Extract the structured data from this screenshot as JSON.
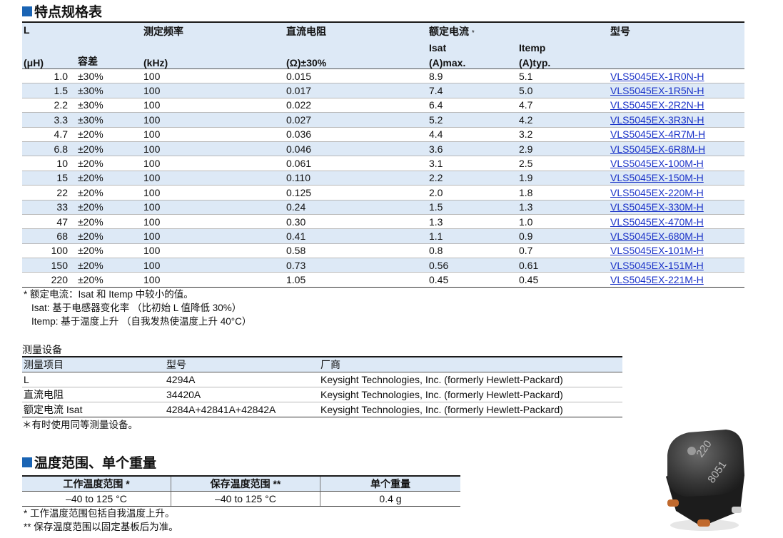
{
  "spec_section": {
    "title": "特点规格表",
    "headers": {
      "l": "L",
      "l_unit": "(μH)",
      "tolerance": "容差",
      "freq": "测定频率",
      "freq_unit": "(kHz)",
      "dcr": "直流电阻",
      "dcr_unit": "(Ω)±30%",
      "rated_current": "额定电流",
      "rated_star": "*",
      "isat": "Isat",
      "isat_unit": "(A)max.",
      "itemp": "Itemp",
      "itemp_unit": "(A)typ.",
      "part_no": "型号"
    },
    "rows": [
      {
        "l": "1.0",
        "tol": "±30%",
        "freq": "100",
        "dcr": "0.015",
        "isat": "8.9",
        "itemp": "5.1",
        "part": "VLS5045EX-1R0N-H"
      },
      {
        "l": "1.5",
        "tol": "±30%",
        "freq": "100",
        "dcr": "0.017",
        "isat": "7.4",
        "itemp": "5.0",
        "part": "VLS5045EX-1R5N-H"
      },
      {
        "l": "2.2",
        "tol": "±30%",
        "freq": "100",
        "dcr": "0.022",
        "isat": "6.4",
        "itemp": "4.7",
        "part": "VLS5045EX-2R2N-H"
      },
      {
        "l": "3.3",
        "tol": "±30%",
        "freq": "100",
        "dcr": "0.027",
        "isat": "5.2",
        "itemp": "4.2",
        "part": "VLS5045EX-3R3N-H"
      },
      {
        "l": "4.7",
        "tol": "±20%",
        "freq": "100",
        "dcr": "0.036",
        "isat": "4.4",
        "itemp": "3.2",
        "part": "VLS5045EX-4R7M-H"
      },
      {
        "l": "6.8",
        "tol": "±20%",
        "freq": "100",
        "dcr": "0.046",
        "isat": "3.6",
        "itemp": "2.9",
        "part": "VLS5045EX-6R8M-H"
      },
      {
        "l": "10",
        "tol": "±20%",
        "freq": "100",
        "dcr": "0.061",
        "isat": "3.1",
        "itemp": "2.5",
        "part": "VLS5045EX-100M-H"
      },
      {
        "l": "15",
        "tol": "±20%",
        "freq": "100",
        "dcr": "0.110",
        "isat": "2.2",
        "itemp": "1.9",
        "part": "VLS5045EX-150M-H"
      },
      {
        "l": "22",
        "tol": "±20%",
        "freq": "100",
        "dcr": "0.125",
        "isat": "2.0",
        "itemp": "1.8",
        "part": "VLS5045EX-220M-H"
      },
      {
        "l": "33",
        "tol": "±20%",
        "freq": "100",
        "dcr": "0.24",
        "isat": "1.5",
        "itemp": "1.3",
        "part": "VLS5045EX-330M-H"
      },
      {
        "l": "47",
        "tol": "±20%",
        "freq": "100",
        "dcr": "0.30",
        "isat": "1.3",
        "itemp": "1.0",
        "part": "VLS5045EX-470M-H"
      },
      {
        "l": "68",
        "tol": "±20%",
        "freq": "100",
        "dcr": "0.41",
        "isat": "1.1",
        "itemp": "0.9",
        "part": "VLS5045EX-680M-H"
      },
      {
        "l": "100",
        "tol": "±20%",
        "freq": "100",
        "dcr": "0.58",
        "isat": "0.8",
        "itemp": "0.7",
        "part": "VLS5045EX-101M-H"
      },
      {
        "l": "150",
        "tol": "±20%",
        "freq": "100",
        "dcr": "0.73",
        "isat": "0.56",
        "itemp": "0.61",
        "part": "VLS5045EX-151M-H"
      },
      {
        "l": "220",
        "tol": "±20%",
        "freq": "100",
        "dcr": "1.05",
        "isat": "0.45",
        "itemp": "0.45",
        "part": "VLS5045EX-221M-H"
      }
    ],
    "notes": [
      "* 额定电流：Isat 和 Itemp 中较小的值。",
      "Isat: 基于电感器变化率 （比初始 L 值降低 30%）",
      "Itemp: 基于温度上升 （自我发热使温度上升 40°C）"
    ]
  },
  "measurement": {
    "title": "测量设备",
    "headers": {
      "item": "测量项目",
      "model": "型号",
      "maker": "厂商"
    },
    "rows": [
      {
        "item": "L",
        "model": "4294A",
        "maker": "Keysight Technologies, Inc. (formerly Hewlett-Packard)"
      },
      {
        "item": "直流电阻",
        "model": "34420A",
        "maker": "Keysight Technologies, Inc. (formerly Hewlett-Packard)"
      },
      {
        "item": "额定电流 Isat",
        "model": "4284A+42841A+42842A",
        "maker": "Keysight Technologies, Inc. (formerly Hewlett-Packard)"
      }
    ],
    "note": "＊有时使用同等测量设备。"
  },
  "temperature": {
    "title": "温度范围、单个重量",
    "headers": {
      "op": "工作温度范围 *",
      "storage": "保存温度范围 **",
      "weight": "单个重量"
    },
    "row": {
      "op": "–40 to 125 °C",
      "storage": "–40 to 125 °C",
      "weight": "0.4 g"
    },
    "notes": [
      "*  工作温度范围包括自我温度上升。",
      "** 保存温度范围以固定基板后为准。"
    ]
  },
  "photo": {
    "marking_line1": "220",
    "marking_line2": "8051"
  },
  "colors": {
    "accent": "#1a64b4",
    "header_bg": "#dde9f6",
    "link": "#1a32c8"
  }
}
